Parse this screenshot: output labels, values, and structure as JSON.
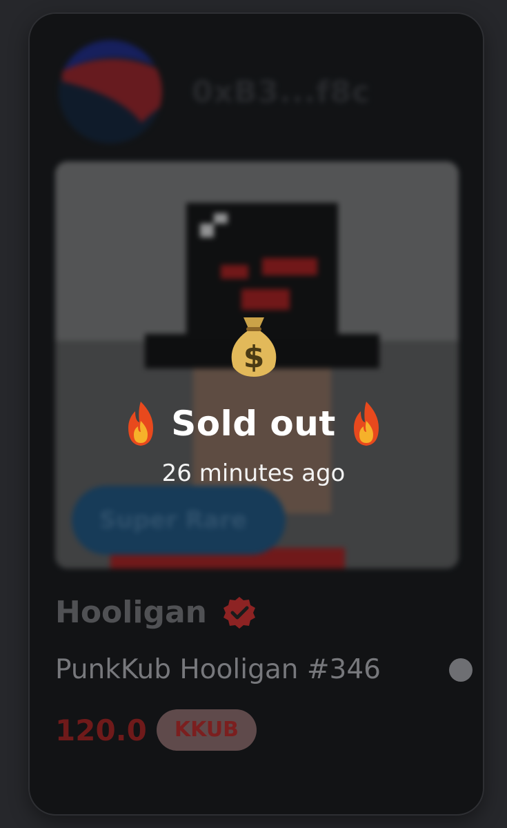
{
  "owner": {
    "name": "0xB3...f8c"
  },
  "art": {
    "badge_label": "Super Rare"
  },
  "collection": {
    "name": "Hooligan",
    "verified": true
  },
  "item": {
    "name": "PunkKub Hooligan #346"
  },
  "price": {
    "amount": "120.0",
    "currency": "KKUB"
  },
  "status": {
    "label": "Sold out",
    "time": "26 minutes ago",
    "icons": [
      "money-bag-icon",
      "fire-icon"
    ]
  },
  "colors": {
    "background": "#26272b",
    "card": "#161719",
    "price": "#6f1a1a",
    "verified": "#8d2323"
  }
}
